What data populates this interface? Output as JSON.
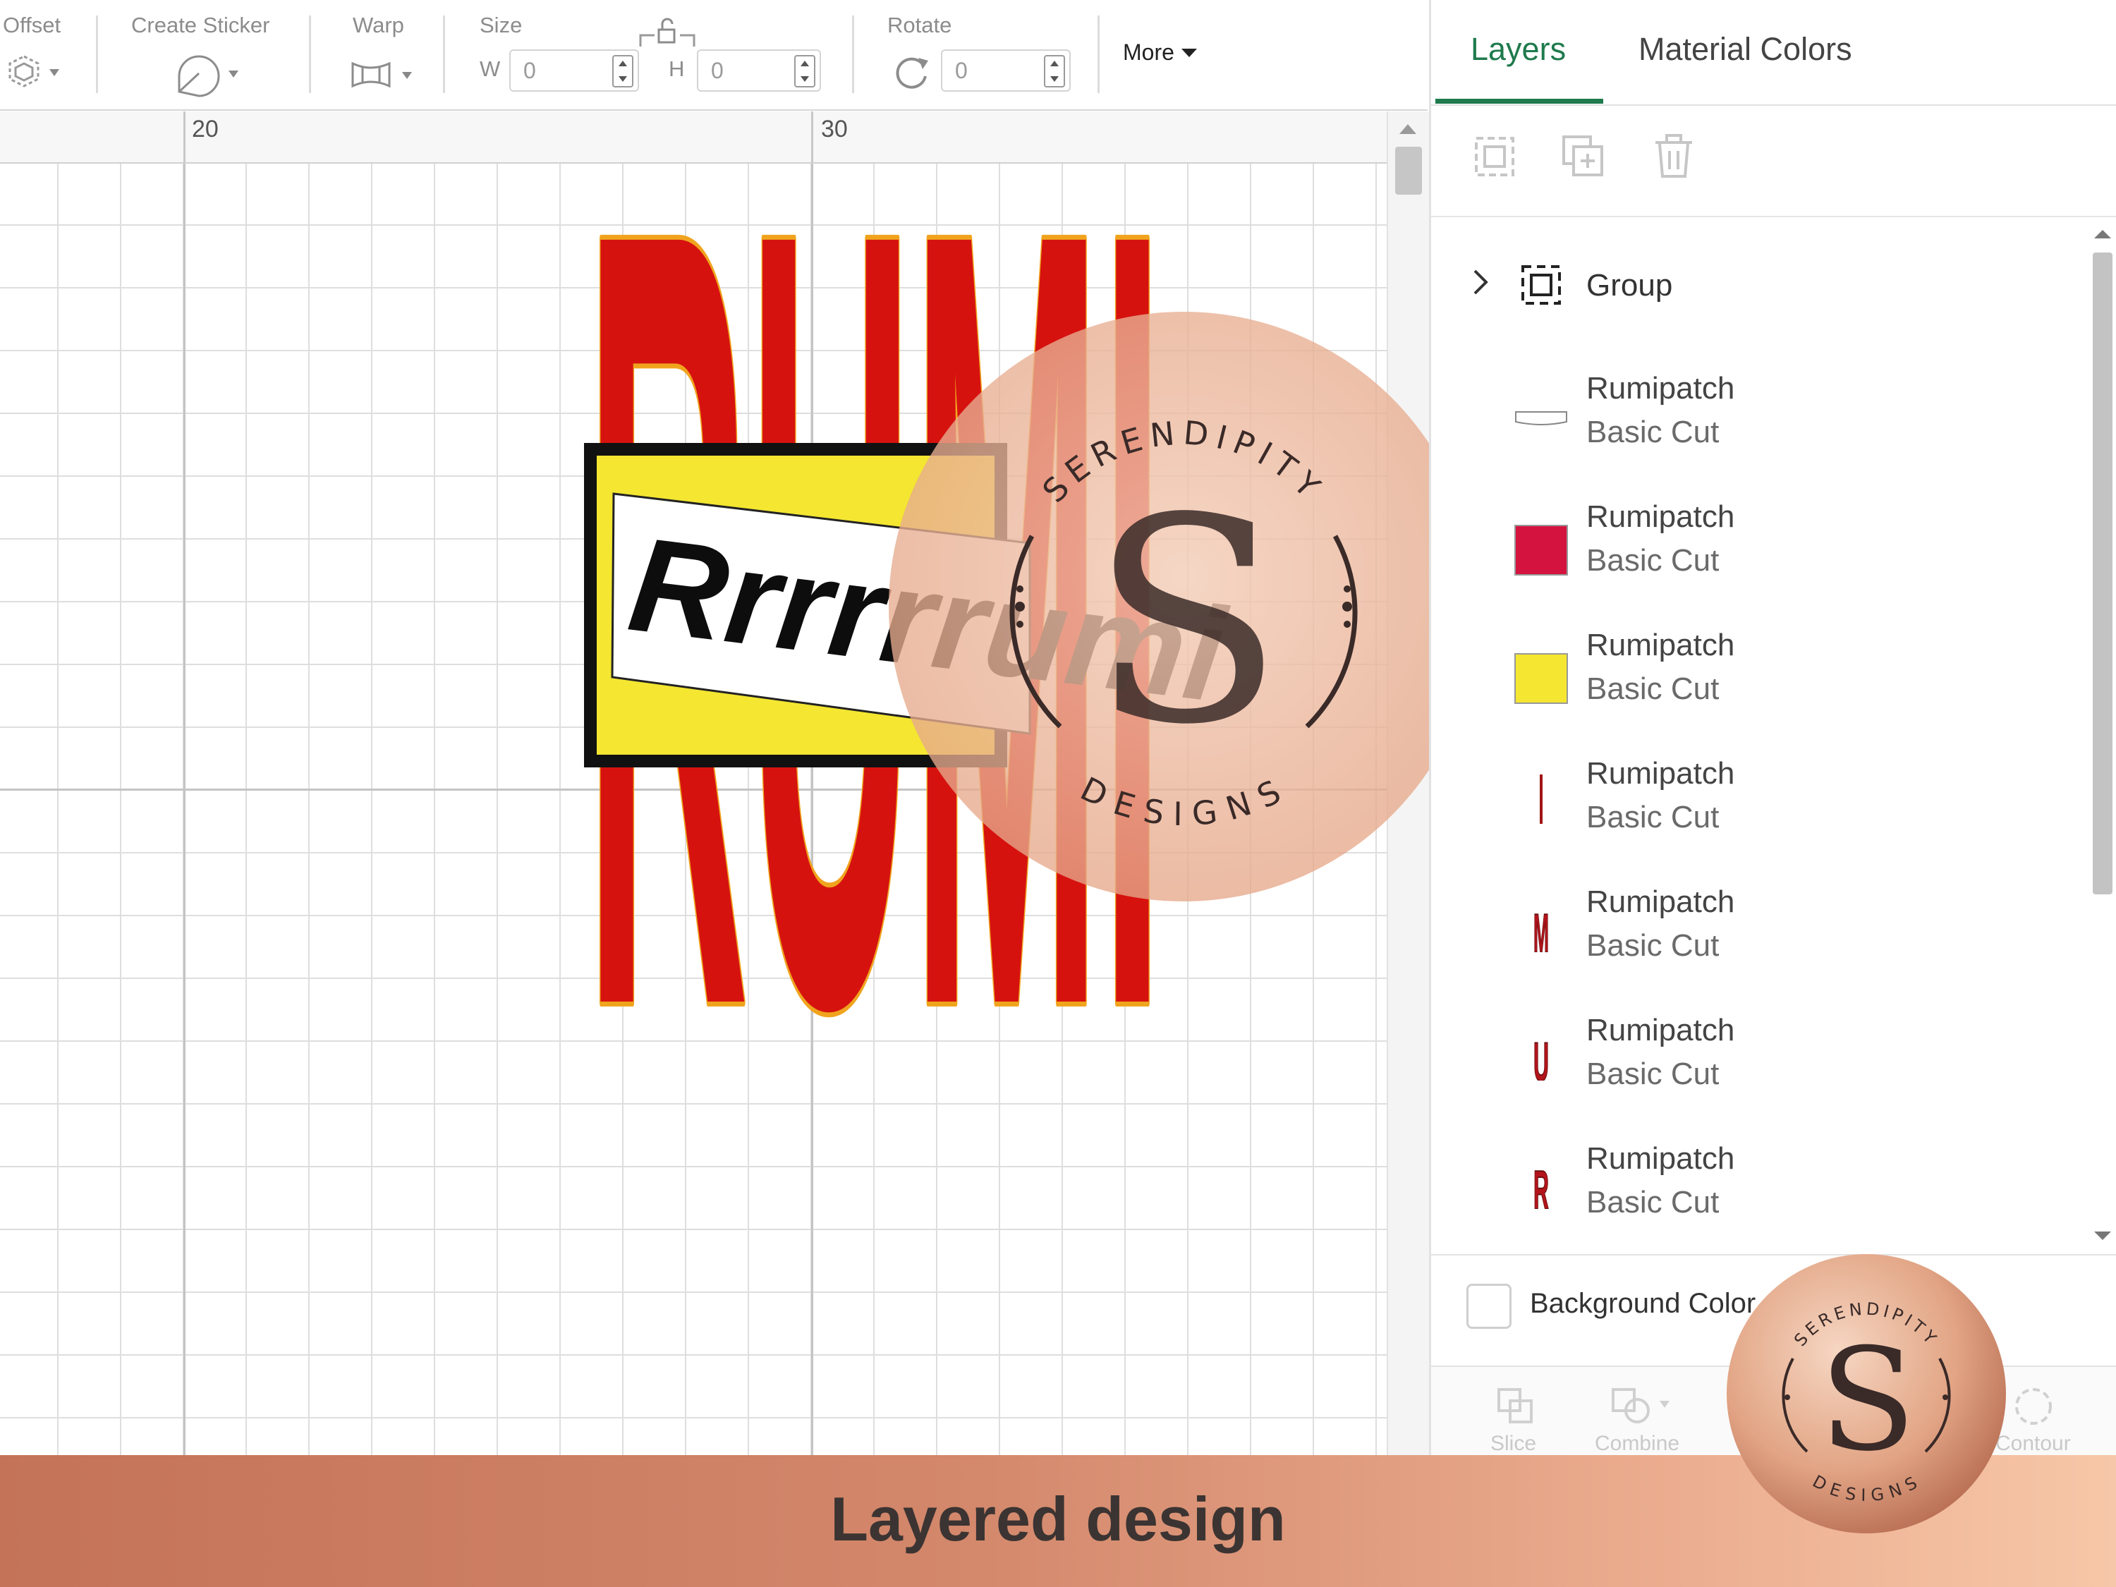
{
  "toolbar": {
    "offset_label": "Offset",
    "create_sticker_label": "Create Sticker",
    "warp_label": "Warp",
    "size_label": "Size",
    "width_letter": "W",
    "width_value": "0",
    "height_letter": "H",
    "height_value": "0",
    "rotate_label": "Rotate",
    "rotate_value": "0",
    "more_label": "More"
  },
  "ruler": {
    "marks": [
      "20",
      "30"
    ]
  },
  "design": {
    "main_word": "RUMI",
    "banner_text": "Rrrrrrumi",
    "colors": {
      "fill": "#d6120f",
      "outline": "#f0a41e",
      "banner": "#f4e631"
    }
  },
  "panel": {
    "tabs": [
      "Layers",
      "Material Colors"
    ],
    "active_tab": "Layers",
    "accent": "#1f7a4d",
    "group_label": "Group",
    "layers": [
      {
        "name": "Rumipatch",
        "operation": "Basic Cut",
        "thumb": "outline-shape"
      },
      {
        "name": "Rumipatch",
        "operation": "Basic Cut",
        "thumb": "crimson-swatch",
        "color": "#d4143f"
      },
      {
        "name": "Rumipatch",
        "operation": "Basic Cut",
        "thumb": "yellow-swatch",
        "color": "#f4e631"
      },
      {
        "name": "Rumipatch",
        "operation": "Basic Cut",
        "thumb": "thin-line"
      },
      {
        "name": "Rumipatch",
        "operation": "Basic Cut",
        "thumb": "letter-m"
      },
      {
        "name": "Rumipatch",
        "operation": "Basic Cut",
        "thumb": "letter-u"
      },
      {
        "name": "Rumipatch",
        "operation": "Basic Cut",
        "thumb": "letter-r"
      }
    ],
    "background_color_label": "Background Color",
    "bottom_tools": [
      "Slice",
      "Combine",
      "Contour"
    ]
  },
  "watermark": {
    "top_text": "SERENDIPITY",
    "bottom_text": "DESIGNS",
    "monogram": "S"
  },
  "caption": "Layered design"
}
